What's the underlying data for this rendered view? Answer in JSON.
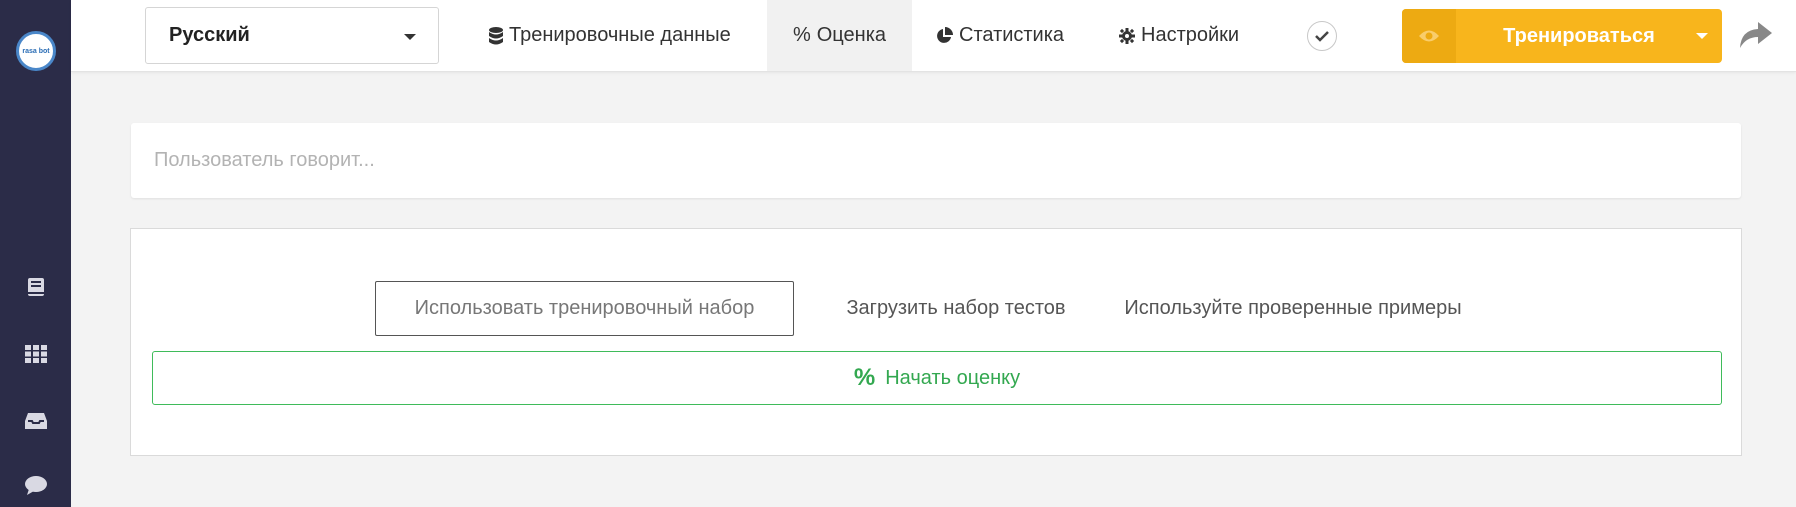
{
  "sidebar": {
    "logo_text": "rasa bot",
    "items": [
      {
        "icon": "book-icon"
      },
      {
        "icon": "grid-icon"
      },
      {
        "icon": "inbox-icon"
      },
      {
        "icon": "chat-bubble-icon"
      }
    ]
  },
  "header": {
    "language": "Русский",
    "tabs": [
      {
        "label": "Тренировочные данные",
        "icon": "database-icon",
        "active": false
      },
      {
        "label": "Оценка",
        "icon": "percent-icon",
        "active": true
      },
      {
        "label": "Статистика",
        "icon": "pie-chart-icon",
        "active": false
      },
      {
        "label": "Настройки",
        "icon": "gear-icon",
        "active": false
      }
    ],
    "train_button": {
      "label": "Тренироваться",
      "icon": "eye-icon"
    },
    "accent_color": "#f8b51c"
  },
  "input": {
    "placeholder": "Пользователь говорит...",
    "value": ""
  },
  "evaluation": {
    "options": [
      {
        "label": "Использовать тренировочный набор",
        "selected": true
      },
      {
        "label": "Загрузить набор тестов",
        "selected": false
      },
      {
        "label": "Используйте проверенные примеры",
        "selected": false
      }
    ],
    "start_button": {
      "label": "Начать оценку",
      "icon": "percent-icon"
    },
    "start_color": "#3fbb5a"
  }
}
